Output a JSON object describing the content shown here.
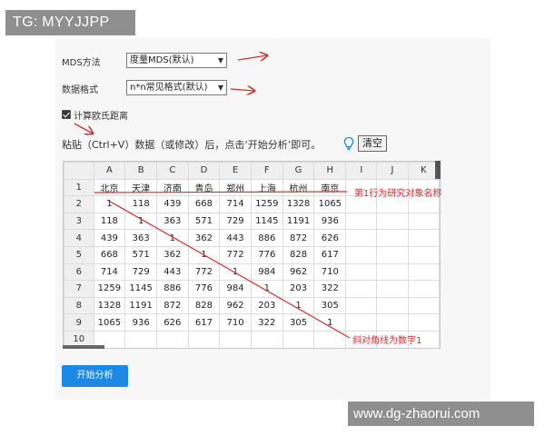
{
  "watermarks": {
    "top_left": "TG: MYYJJPP",
    "bottom_right": "www.dg-zhaorui.com"
  },
  "form": {
    "mds_label": "MDS方法",
    "mds_value": "度量MDS(默认)",
    "format_label": "数据格式",
    "format_value": "n*n常见格式(默认)",
    "euclid_label": "计算欧氏距离",
    "euclid_checked": true
  },
  "instruction": "粘贴（Ctrl+V）数据（或修改）后，点击‘开始分析’即可。",
  "clear_label": "清空",
  "start_label": "开始分析",
  "annotations": {
    "row1_note": "第1行为研究对象名称",
    "diag_note": "斜对角线为数字1"
  },
  "grid": {
    "col_headers": [
      "",
      "A",
      "B",
      "C",
      "D",
      "E",
      "F",
      "G",
      "H",
      "I",
      "J",
      "K"
    ],
    "rows": [
      [
        "1",
        "北京",
        "天津",
        "济南",
        "青岛",
        "郑州",
        "上海",
        "杭州",
        "南京",
        "",
        "",
        ""
      ],
      [
        "2",
        "1",
        "118",
        "439",
        "668",
        "714",
        "1259",
        "1328",
        "1065",
        "",
        "",
        ""
      ],
      [
        "3",
        "118",
        "1",
        "363",
        "571",
        "729",
        "1145",
        "1191",
        "936",
        "",
        "",
        ""
      ],
      [
        "4",
        "439",
        "363",
        "1",
        "362",
        "443",
        "886",
        "872",
        "626",
        "",
        "",
        ""
      ],
      [
        "5",
        "668",
        "571",
        "362",
        "1",
        "772",
        "776",
        "828",
        "617",
        "",
        "",
        ""
      ],
      [
        "6",
        "714",
        "729",
        "443",
        "772",
        "1",
        "984",
        "962",
        "710",
        "",
        "",
        ""
      ],
      [
        "7",
        "1259",
        "1145",
        "886",
        "776",
        "984",
        "1",
        "203",
        "322",
        "",
        "",
        ""
      ],
      [
        "8",
        "1328",
        "1191",
        "872",
        "828",
        "962",
        "203",
        "1",
        "305",
        "",
        "",
        ""
      ],
      [
        "9",
        "1065",
        "936",
        "626",
        "617",
        "710",
        "322",
        "305",
        "1",
        "",
        "",
        ""
      ],
      [
        "10",
        "",
        "",
        "",
        "",
        "",
        "",
        "",
        "",
        "",
        "",
        ""
      ]
    ]
  },
  "colors": {
    "accent": "#1e88e5",
    "annotation": "#d32f2f"
  }
}
